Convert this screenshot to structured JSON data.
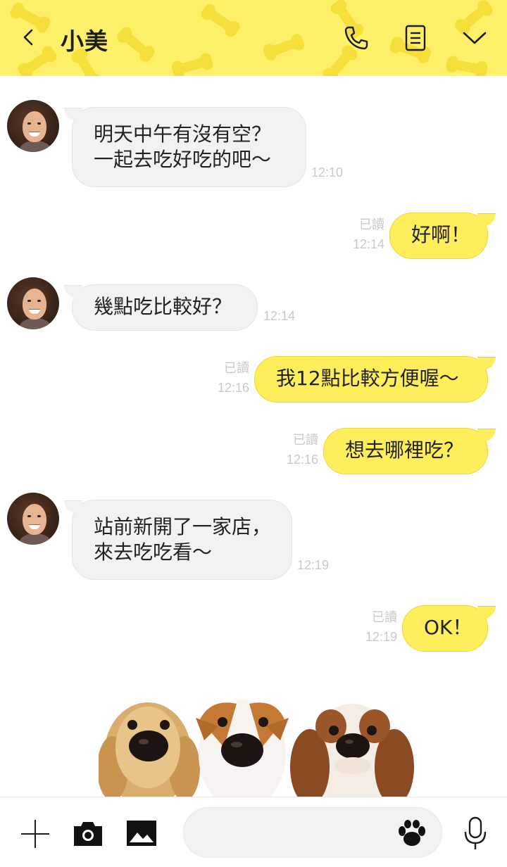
{
  "header": {
    "title": "小美"
  },
  "messages": [
    {
      "side": "in",
      "text": "明天中午有沒有空？\n一起去吃好吃的吧～",
      "time": "12:10"
    },
    {
      "side": "out",
      "text": "好啊！",
      "read": "已讀",
      "time": "12:14"
    },
    {
      "side": "in",
      "text": "幾點吃比較好？",
      "time": "12:14"
    },
    {
      "side": "out",
      "text": "我12點比較方便喔～",
      "read": "已讀",
      "time": "12:16"
    },
    {
      "side": "out",
      "text": "想去哪裡吃？",
      "read": "已讀",
      "time": "12:16"
    },
    {
      "side": "in",
      "text": "站前新開了一家店，\n來去吃吃看～",
      "time": "12:19"
    },
    {
      "side": "out",
      "text": "OK！",
      "read": "已讀",
      "time": "12:19"
    }
  ],
  "input": {
    "placeholder": ""
  },
  "colors": {
    "header_bg": "#fff06a",
    "outgoing_bubble": "#ffee5c",
    "incoming_bubble": "#f2f2f2"
  },
  "icons": [
    "back-icon",
    "phone-icon",
    "note-icon",
    "chevron-down-icon",
    "plus-icon",
    "camera-icon",
    "image-icon",
    "paw-icon",
    "mic-icon"
  ]
}
